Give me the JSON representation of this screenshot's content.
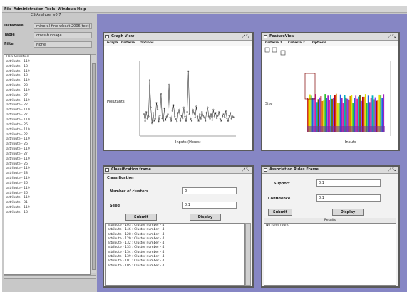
{
  "menubar": [
    "File",
    "Administration",
    "Tools",
    "Windows",
    "Help"
  ],
  "app_title": "CS Analyzer v0.7",
  "properties": [
    {
      "label": "Database",
      "value": "mineral-fine-wheat 2006(text)"
    },
    {
      "label": "Table",
      "value": "cross-tunnage"
    },
    {
      "label": "Filter",
      "value": "None"
    }
  ],
  "attribute_list": [
    "Row Selection",
    "attribute - 119",
    "attribute - 18",
    "attribute - 119",
    "attribute - 18",
    "attribute - 119",
    "attribute - 28",
    "attribute - 119",
    "attribute - 27",
    "attribute - 119",
    "attribute - 22",
    "attribute - 119",
    "attribute - 27",
    "attribute - 119",
    "attribute - 26",
    "attribute - 119",
    "attribute - 22",
    "attribute - 119",
    "attribute - 26",
    "attribute - 119",
    "attribute - 27",
    "attribute - 119",
    "attribute - 26",
    "attribute - 119",
    "attribute - 28",
    "attribute - 119",
    "attribute - 26",
    "attribute - 119",
    "attribute - 26",
    "attribute - 119",
    "attribute - 31",
    "attribute - 119",
    "attribute - 18"
  ],
  "graph_window": {
    "title": "Graph View",
    "menu": [
      "Graph",
      "Criteria",
      "Options"
    ],
    "ylabel": "Pollutants",
    "xlabel": "Inputs (Hours)",
    "chart_data": {
      "type": "line",
      "x": [
        1,
        2,
        3,
        4,
        5,
        6,
        7,
        8,
        9,
        10,
        11,
        12,
        13,
        14,
        15,
        16,
        17,
        18,
        19,
        20,
        21,
        22,
        23,
        24,
        25,
        26,
        27,
        28,
        29,
        30,
        31,
        32,
        33,
        34,
        35,
        36,
        37,
        38,
        39,
        40,
        41,
        42,
        43,
        44,
        45,
        46,
        47,
        48,
        49,
        50,
        51,
        52,
        53,
        54,
        55,
        56,
        57,
        58,
        59,
        60,
        61,
        62,
        63,
        64,
        65,
        66,
        67,
        68,
        69,
        70,
        71,
        72,
        73,
        74,
        75,
        76,
        77,
        78,
        79,
        80
      ],
      "values": [
        45,
        30,
        50,
        35,
        40,
        120,
        60,
        25,
        48,
        30,
        35,
        70,
        55,
        28,
        42,
        90,
        36,
        30,
        58,
        32,
        40,
        45,
        110,
        38,
        30,
        52,
        65,
        40,
        35,
        28,
        48,
        55,
        30,
        42,
        36,
        60,
        40,
        30,
        50,
        140,
        45,
        35,
        30,
        55,
        48,
        38,
        62,
        40,
        30,
        45,
        35,
        50,
        42,
        38,
        30,
        48,
        60,
        40,
        35,
        45,
        32,
        55,
        40,
        48,
        36,
        42,
        50,
        35,
        30,
        40,
        45,
        38,
        52,
        36,
        30,
        42,
        48,
        35,
        40,
        38
      ],
      "ylim": [
        0,
        160
      ],
      "xlabel": "Inputs (Hours)",
      "ylabel": "Pollutants",
      "grid": false
    }
  },
  "feature_window": {
    "title": "FeatureView",
    "menu": [
      "Criteria 1",
      "Criteria 2",
      "Options"
    ],
    "ylabel": "Size",
    "xlabel": "Inputs",
    "colors": [
      "#c00000",
      "#e08000",
      "#e0e000",
      "#30c030",
      "#2060e0",
      "#a020c0",
      "#e020a0",
      "#00b0c0",
      "#606000",
      "#8040ff"
    ]
  },
  "classification_window": {
    "title": "Classification frame",
    "subtitle": "Classification",
    "clusters_label": "Number of clusters",
    "clusters_value": "8",
    "seed_label": "Seed",
    "seed_value": "0.1",
    "submit_label": "Submit",
    "display_label": "Display",
    "results": [
      "attribute - 103 : Cluster number - 4",
      "attribute - 146 : Cluster number - 4",
      "attribute - 128 : Cluster number - 4",
      "attribute - 129 : Cluster number - 4",
      "attribute - 132 : Cluster number - 4",
      "attribute - 133 : Cluster number - 4",
      "attribute - 134 : Cluster number - 4",
      "attribute - 139 : Cluster number - 4",
      "attribute - 101 : Cluster number - 4",
      "attribute - 105 : Cluster number - 4"
    ]
  },
  "association_window": {
    "title": "Association Rules Frame",
    "support_label": "Support",
    "support_value": "0.1",
    "confidence_label": "Confidence",
    "confidence_value": "0.1",
    "submit_label": "Submit",
    "display_label": "Display",
    "results_header": "Results",
    "results_text": "No rules found"
  }
}
